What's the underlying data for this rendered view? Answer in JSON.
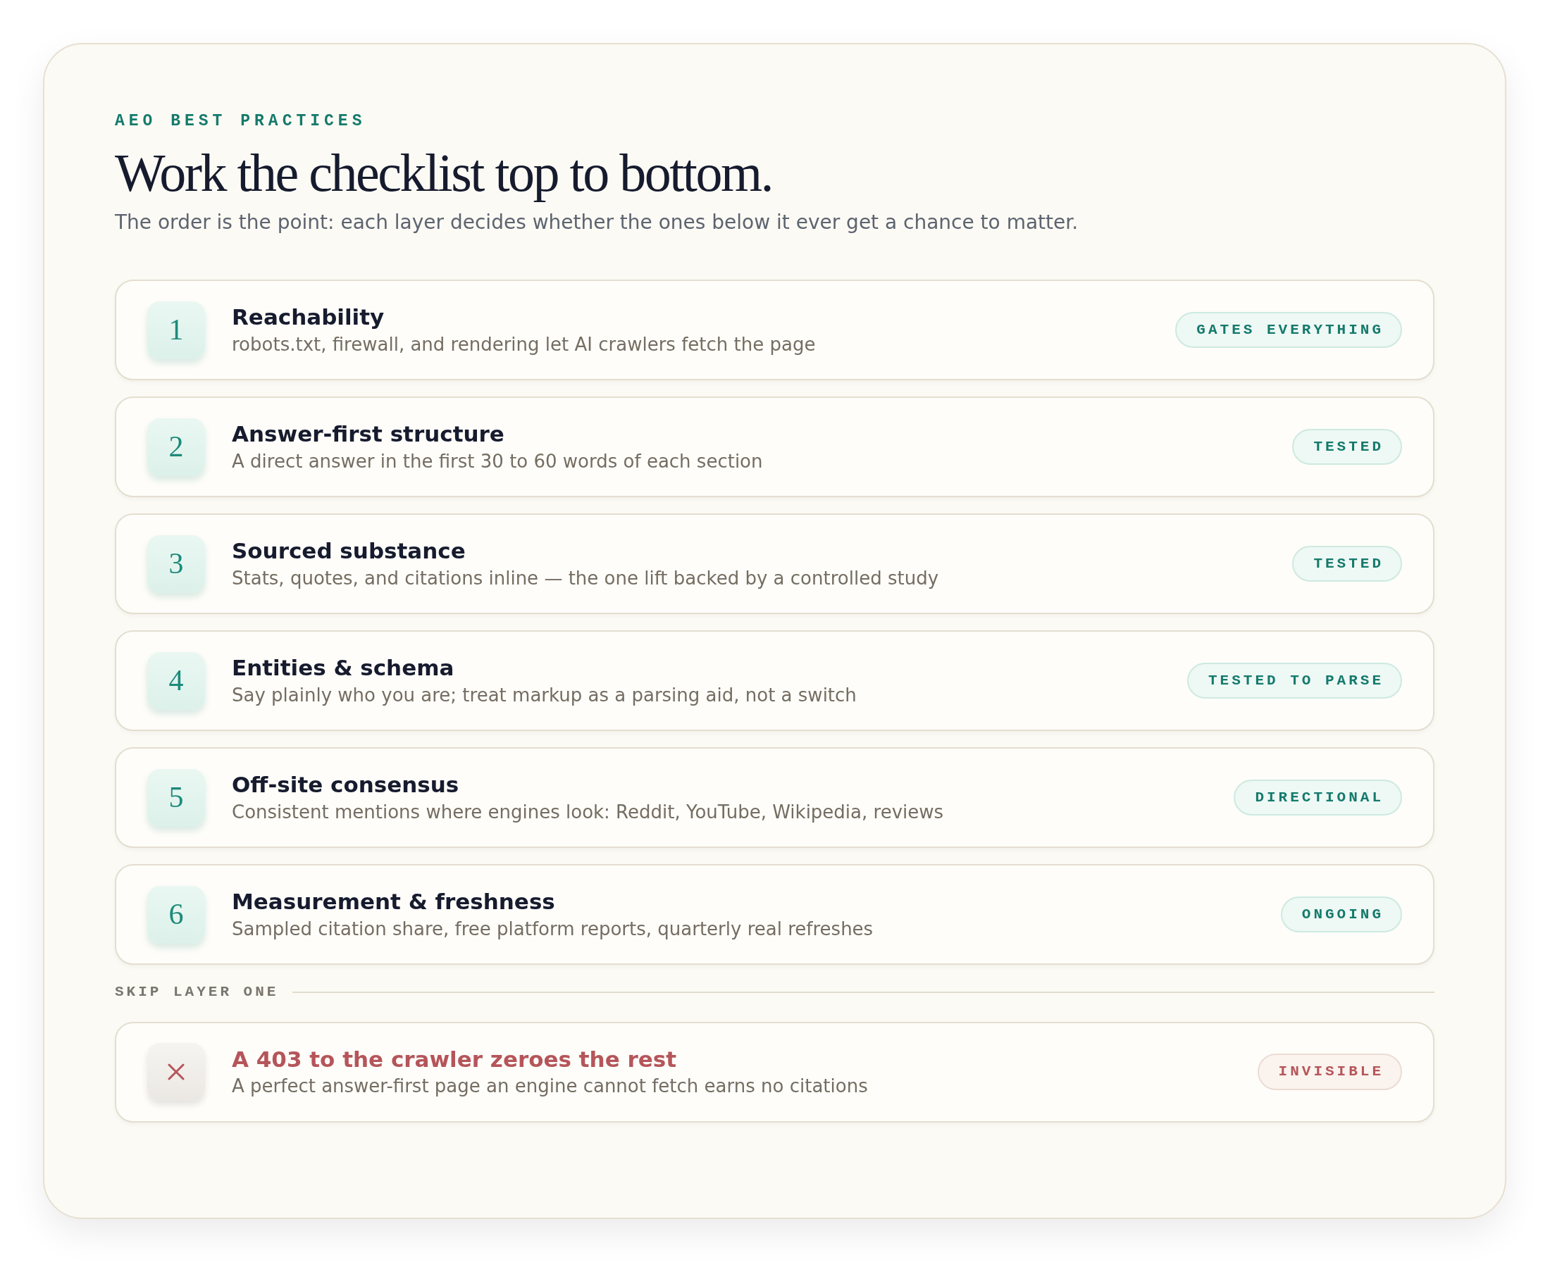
{
  "eyebrow": "AEO BEST PRACTICES",
  "title": "Work the checklist top to bottom.",
  "subtitle": "The order is the point: each layer decides whether the ones below it ever get a chance to matter.",
  "steps": [
    {
      "number": "1",
      "title": "Reachability",
      "description": "robots.txt, firewall, and rendering let AI crawlers fetch the page",
      "tag": "GATES EVERYTHING"
    },
    {
      "number": "2",
      "title": "Answer-first structure",
      "description": "A direct answer in the first 30 to 60 words of each section",
      "tag": "TESTED"
    },
    {
      "number": "3",
      "title": "Sourced substance",
      "description": "Stats, quotes, and citations inline — the one lift backed by a controlled study",
      "tag": "TESTED"
    },
    {
      "number": "4",
      "title": "Entities & schema",
      "description": "Say plainly who you are; treat markup as a parsing aid, not a switch",
      "tag": "TESTED TO PARSE"
    },
    {
      "number": "5",
      "title": "Off-site consensus",
      "description": "Consistent mentions where engines look: Reddit, YouTube, Wikipedia, reviews",
      "tag": "DIRECTIONAL"
    },
    {
      "number": "6",
      "title": "Measurement & freshness",
      "description": "Sampled citation share, free platform reports, quarterly real refreshes",
      "tag": "ONGOING"
    }
  ],
  "divider_label": "SKIP LAYER ONE",
  "warning": {
    "title": "A 403 to the crawler zeroes the rest",
    "description": "A perfect answer-first page an engine cannot fetch earns no citations",
    "tag": "INVISIBLE"
  }
}
